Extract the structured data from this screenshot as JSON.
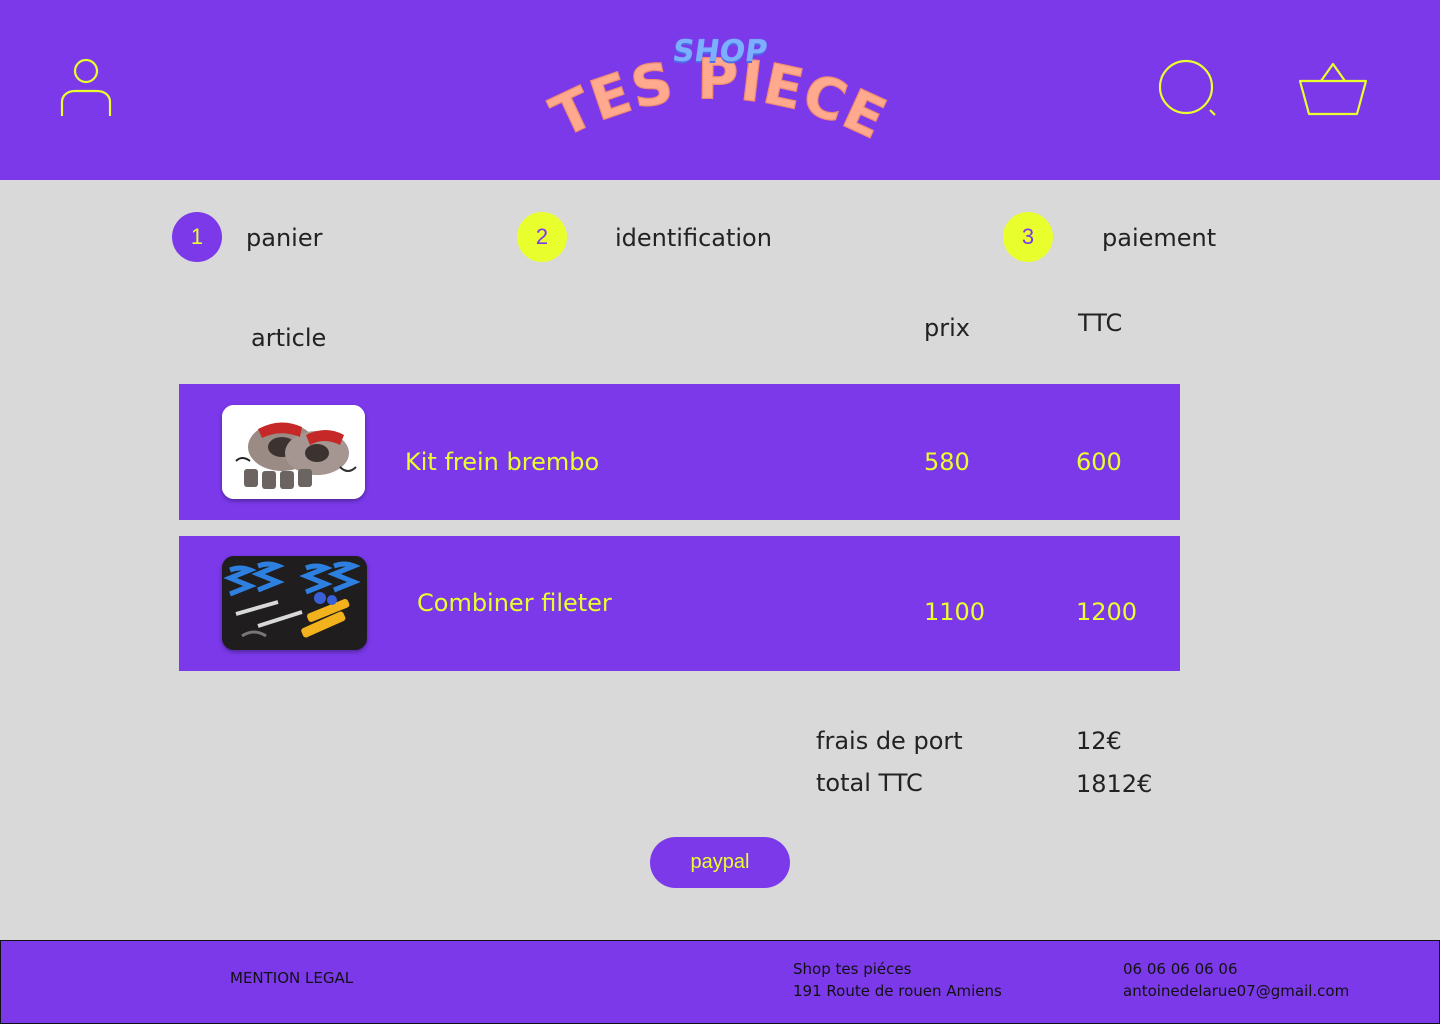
{
  "colors": {
    "accent": "#7b39ea",
    "highlight": "#e9ff2d",
    "background": "#d9d9d9",
    "text": "#222222",
    "logo_shop": "#7cb0ff",
    "logo_main": "#ffa98f"
  },
  "header": {
    "icons": [
      "user-icon",
      "search-icon",
      "basket-icon"
    ],
    "logo": {
      "shop": "SHOP",
      "main": "TES PIECE"
    }
  },
  "steps": [
    {
      "number": "1",
      "label": "panier",
      "active": true
    },
    {
      "number": "2",
      "label": "identification",
      "active": false
    },
    {
      "number": "3",
      "label": "paiement",
      "active": false
    }
  ],
  "table": {
    "headers": {
      "article": "article",
      "prix": "prix",
      "ttc": "TTC"
    },
    "items": [
      {
        "name": "Kit frein brembo",
        "prix": "580",
        "ttc": "600",
        "image_icon": "brake-kit-image"
      },
      {
        "name": "Combiner fileter",
        "prix": "1100",
        "ttc": "1200",
        "image_icon": "coilover-kit-image"
      }
    ]
  },
  "summary": {
    "shipping_label": "frais de port",
    "shipping_value": "12€",
    "total_label": "total TTC",
    "total_value": "1812€"
  },
  "paypal_label": "paypal",
  "footer": {
    "legal": "MENTION LEGAL",
    "shop_name": "Shop tes piéces",
    "address": "191 Route de rouen Amiens",
    "phone": "06 06 06 06 06",
    "email": "antoinedelarue07@gmail.com"
  }
}
